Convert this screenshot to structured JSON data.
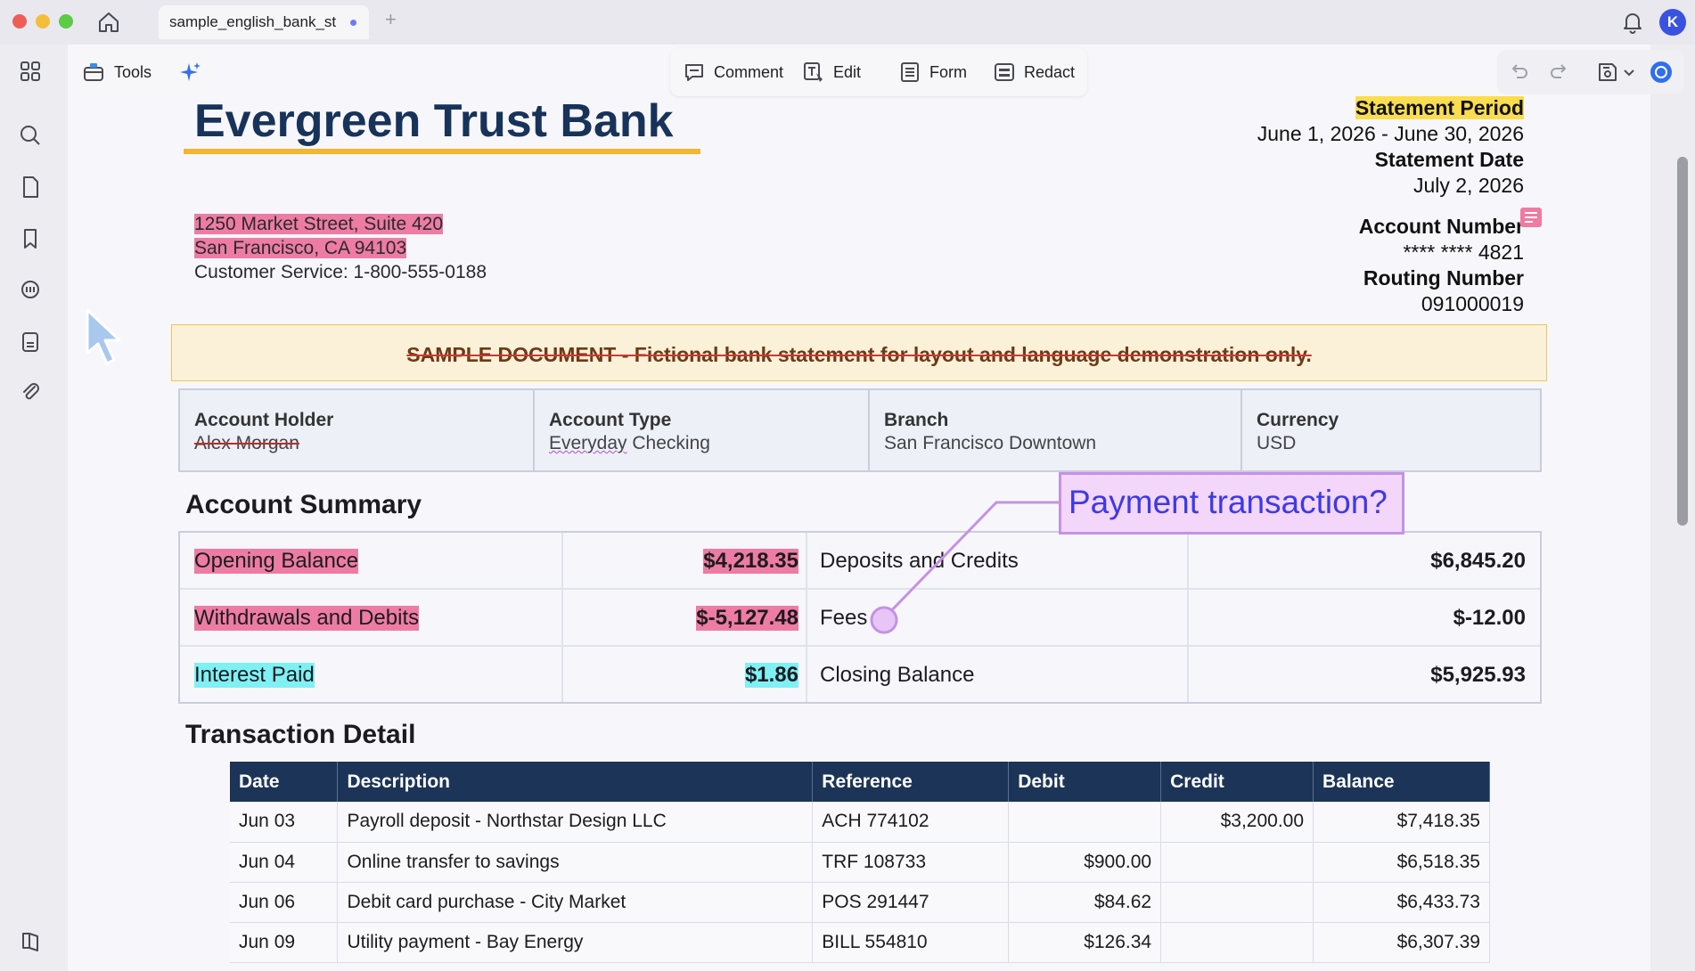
{
  "window": {
    "tab_title": "sample_english_bank_st",
    "new_tab_label": "+",
    "avatar_initial": "K"
  },
  "toolbar": {
    "tools_label": "Tools",
    "comment_label": "Comment",
    "edit_label": "Edit",
    "form_label": "Form",
    "redact_label": "Redact"
  },
  "document": {
    "bank_name": "Evergreen Trust Bank",
    "address_line1": "1250 Market Street, Suite 420",
    "address_line2": "San Francisco, CA 94103",
    "customer_service": "Customer Service: 1-800-555-0188",
    "statement_period_label": "Statement Period",
    "statement_period_value": "June 1, 2026 - June 30, 2026",
    "statement_date_label": "Statement Date",
    "statement_date_value": "July 2, 2026",
    "account_number_label": "Account Number",
    "account_number_value": "**** **** 4821",
    "routing_number_label": "Routing Number",
    "routing_number_value": "091000019",
    "banner": "SAMPLE DOCUMENT - Fictional bank statement for layout and language demonstration only.",
    "info": [
      {
        "label": "Account Holder",
        "value": "Alex Morgan"
      },
      {
        "label": "Account Type",
        "value": "Everyday Checking"
      },
      {
        "label": "Branch",
        "value": "San Francisco Downtown"
      },
      {
        "label": "Currency",
        "value": "USD"
      }
    ],
    "summary_title": "Account Summary",
    "summary": [
      {
        "left_label": "Opening Balance",
        "left_amount": "$4,218.35",
        "right_label": "Deposits and Credits",
        "right_amount": "$6,845.20"
      },
      {
        "left_label": "Withdrawals and Debits",
        "left_amount": "$-5,127.48",
        "right_label": "Fees",
        "right_amount": "$-12.00"
      },
      {
        "left_label": "Interest Paid",
        "left_amount": "$1.86",
        "right_label": "Closing Balance",
        "right_amount": "$5,925.93"
      }
    ],
    "callout": "Payment transaction?",
    "transactions_title": "Transaction Detail",
    "transaction_headers": [
      "Date",
      "Description",
      "Reference",
      "Debit",
      "Credit",
      "Balance"
    ],
    "transactions": [
      [
        "Jun 03",
        "Payroll deposit - Northstar Design LLC",
        "ACH 774102",
        "",
        "$3,200.00",
        "$7,418.35"
      ],
      [
        "Jun 04",
        "Online transfer to savings",
        "TRF 108733",
        "$900.00",
        "",
        "$6,518.35"
      ],
      [
        "Jun 06",
        "Debit card purchase - City Market",
        "POS 291447",
        "$84.62",
        "",
        "$6,433.73"
      ],
      [
        "Jun 09",
        "Utility payment - Bay Energy",
        "BILL 554810",
        "$126.34",
        "",
        "$6,307.39"
      ]
    ]
  },
  "colors": {
    "brand_navy": "#18335a",
    "accent_yellow": "#f2b632",
    "highlight_pink": "#ee7ca2",
    "highlight_cyan": "#7ff0f4",
    "callout_purple": "#c591e6"
  }
}
